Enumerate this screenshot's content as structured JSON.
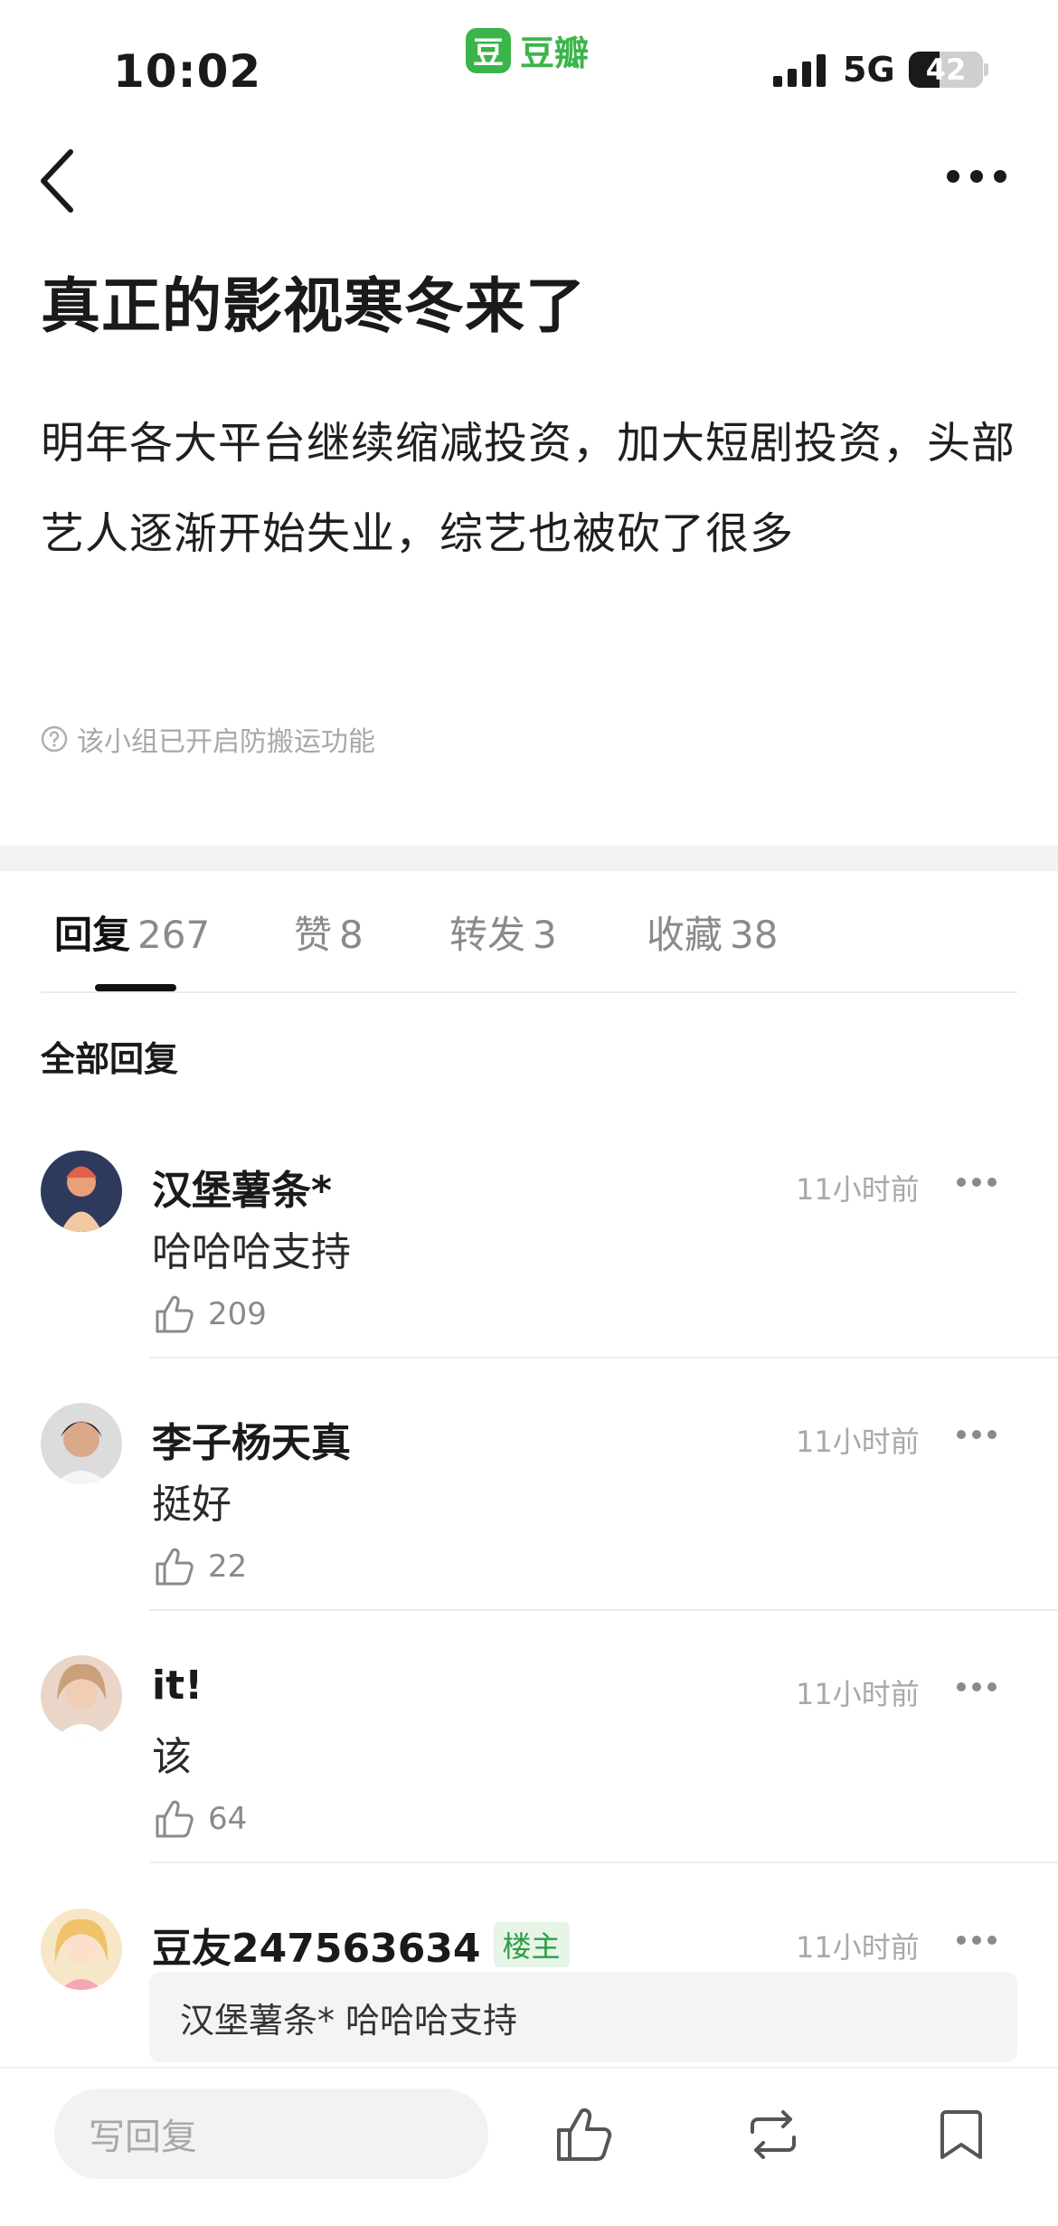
{
  "status_bar": {
    "time": "10:02",
    "app_logo": "豆",
    "app_name": "豆瓣",
    "network": "5G",
    "battery": "42",
    "battery_level": 0.42
  },
  "nav": {
    "back_icon": "chevron-left-icon",
    "more_icon": "more-horizontal-icon"
  },
  "post": {
    "title": "真正的影视寒冬来了",
    "body": "明年各大平台继续缩减投资，加大短剧投资，头部艺人逐渐开始失业，综艺也被砍了很多",
    "notice": "该小组已开启防搬运功能"
  },
  "tabs": [
    {
      "label": "回复",
      "count": "267"
    },
    {
      "label": "赞",
      "count": "8"
    },
    {
      "label": "转发",
      "count": "3"
    },
    {
      "label": "收藏",
      "count": "38"
    }
  ],
  "section_heading": "全部回复",
  "comments": [
    {
      "author": "汉堡薯条*",
      "time": "11小时前",
      "text": "哈哈哈支持",
      "likes": "209"
    },
    {
      "author": "李子杨天真",
      "time": "11小时前",
      "text": "挺好",
      "likes": "22"
    },
    {
      "author": "it!",
      "time": "11小时前",
      "text": "该",
      "likes": "64"
    },
    {
      "author": "豆友247563634",
      "badge": "楼主",
      "time": "11小时前",
      "quote": {
        "author": "汉堡薯条*",
        "text": "哈哈哈支持"
      }
    }
  ],
  "bottom_bar": {
    "reply_placeholder": "写回复",
    "icons": [
      "thumbs-up-icon",
      "repost-icon",
      "bookmark-icon"
    ]
  },
  "colors": {
    "brand_green": "#3bb54a",
    "text_primary": "#1a1a1a",
    "text_secondary": "#a8a8a8",
    "badge_bg": "#e6f5e8",
    "badge_text": "#2e9e44"
  }
}
